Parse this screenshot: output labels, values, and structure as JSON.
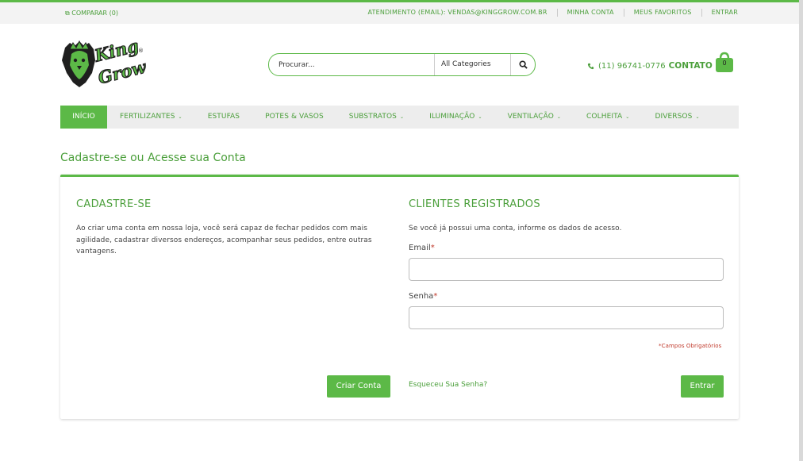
{
  "topbar": {
    "compare": "⧉ COMPARAR (0)",
    "links": [
      "ATENDIMENTO (EMAIL): VENDAS@KINGGROW.COM.BR",
      "MINHA CONTA",
      "MEUS FAVORITOS",
      "ENTRAR"
    ]
  },
  "logo": {
    "line1": "King",
    "line2": "Grow",
    "reg": "®"
  },
  "search": {
    "placeholder": "Procurar...",
    "category": "All Categories"
  },
  "contact": {
    "phone": "(11) 96741-0776",
    "label": "CONTATO"
  },
  "cart": {
    "count": "0"
  },
  "nav": {
    "items": [
      {
        "label": "INÍCIO",
        "dropdown": false
      },
      {
        "label": "FERTILIZANTES",
        "dropdown": true
      },
      {
        "label": "ESTUFAS",
        "dropdown": false
      },
      {
        "label": "POTES & VASOS",
        "dropdown": false
      },
      {
        "label": "SUBSTRATOS",
        "dropdown": true
      },
      {
        "label": "ILUMINAÇÃO",
        "dropdown": true
      },
      {
        "label": "VENTILAÇÃO",
        "dropdown": true
      },
      {
        "label": "COLHEITA",
        "dropdown": true
      },
      {
        "label": "DIVERSOS",
        "dropdown": true
      }
    ]
  },
  "page": {
    "title": "Cadastre-se ou Acesse sua Conta"
  },
  "register": {
    "title": "CADASTRE-SE",
    "text": "Ao criar uma conta em nossa loja, você será capaz de fechar pedidos com mais agilidade, cadastrar diversos endereços, acompanhar seus pedidos, entre outras vantagens.",
    "button": "Criar Conta"
  },
  "login": {
    "title": "CLIENTES REGISTRADOS",
    "intro": "Se você já possui uma conta, informe os dados de acesso.",
    "email_label": "Email",
    "password_label": "Senha",
    "required_mark": "*",
    "required_note": "*Campos Obrigatórios",
    "forgot": "Esqueceu Sua Senha?",
    "button": "Entrar"
  },
  "colors": {
    "brand": "#5cb947",
    "brand_text": "#4b9f3b",
    "required": "#c0392b"
  }
}
